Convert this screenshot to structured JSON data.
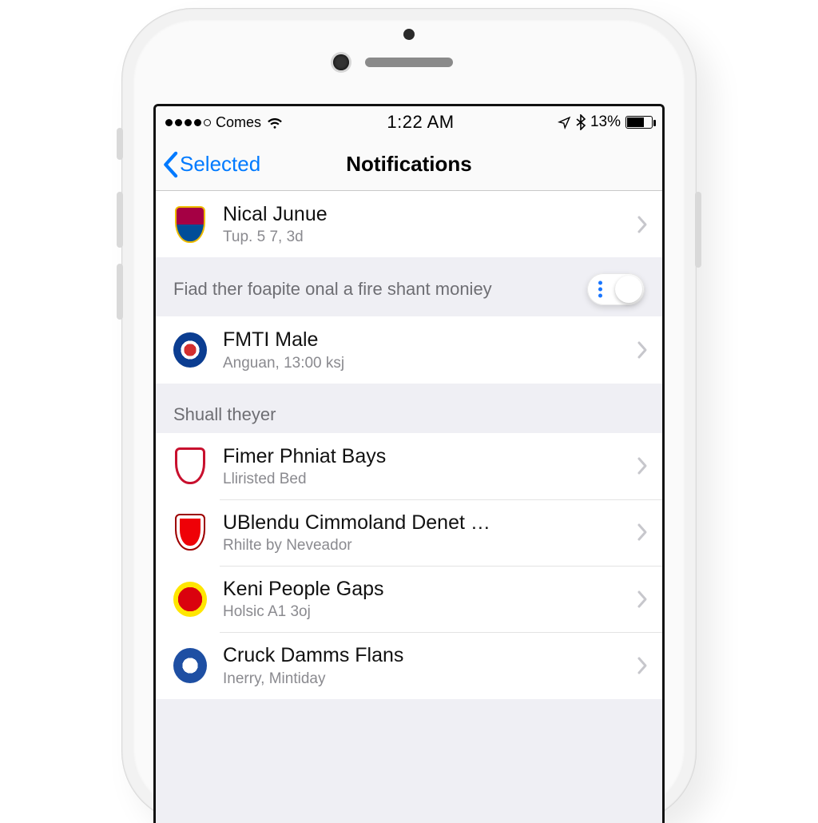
{
  "status": {
    "carrier": "Comes",
    "time": "1:22 AM",
    "battery_pct": "13%"
  },
  "nav": {
    "back_label": "Selected",
    "title": "Notifications"
  },
  "rows_top": [
    {
      "title": "Nical Junue",
      "sub": "Tup. 5 7, 3d",
      "badge": "barca"
    },
    {
      "title": "FMTI Male",
      "sub": "Anguan, 13:00 ksj",
      "badge": "round-blue"
    }
  ],
  "section_desc": "Fiad ther foapite onal a fire shant moniey",
  "section_header": "Shuall theyer",
  "rows_bottom": [
    {
      "title": "Fimer Phniat Bays",
      "sub": "Lliristed Bed",
      "badge": "shield-white-red"
    },
    {
      "title": "UBlendu Cimmoland Denet …",
      "sub": "Rhilte by Neveador",
      "badge": "arsenal"
    },
    {
      "title": "Keni People Gaps",
      "sub": "Holsic A1 3oj",
      "badge": "manutd"
    },
    {
      "title": "Cruck Damms Flans",
      "sub": "Inerry, Mintiday",
      "badge": "round-blue2"
    }
  ],
  "colors": {
    "ios_blue": "#007aff",
    "barca_top": "#a50044",
    "barca_bot": "#004d98",
    "round_blue": "#0b3d91",
    "round_blue_accent": "#d32f2f",
    "shield_white_red": "#ffffff",
    "shield_white_red_border": "#c8102e",
    "arsenal": "#ef0107",
    "manutd": "#ffe600",
    "manutd_inner": "#da020e",
    "round_blue2": "#1e4fa3"
  }
}
